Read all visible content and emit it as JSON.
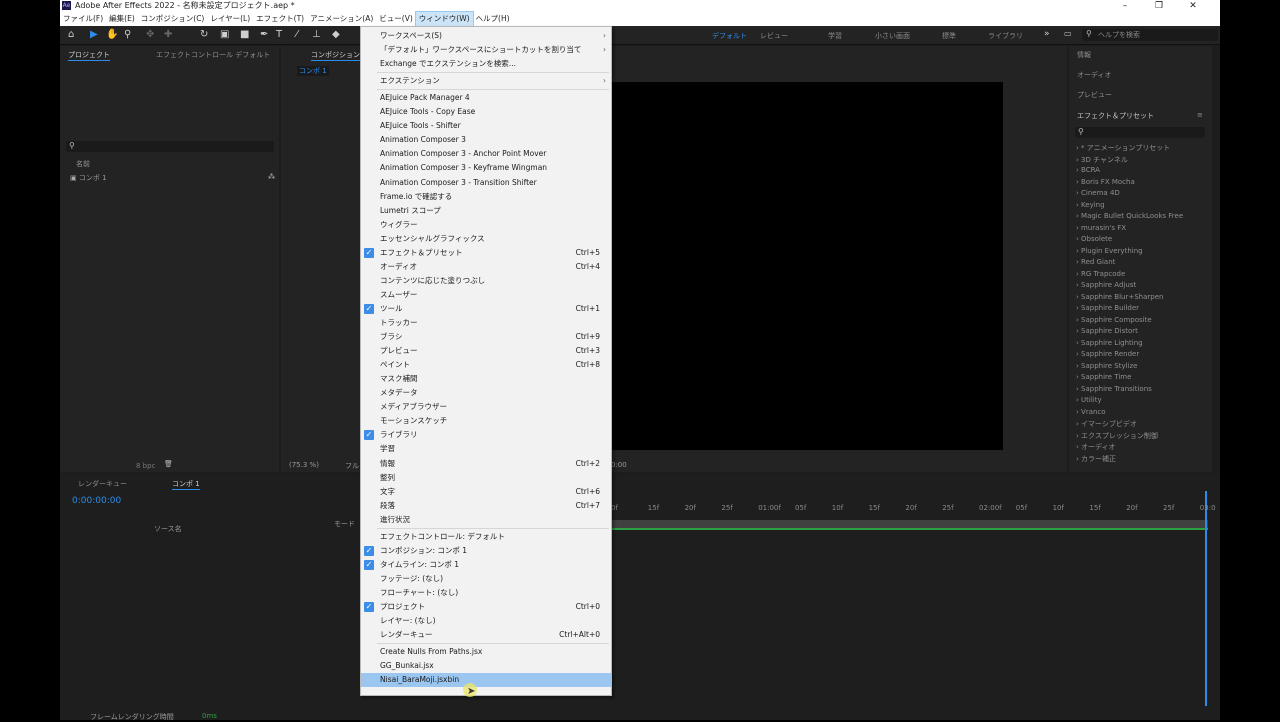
{
  "app": {
    "title": "Adobe After Effects 2022 - 名称未設定プロジェクト.aep *",
    "logo": "Ae",
    "minimize": "–",
    "maximize": "❐",
    "close": "✕"
  },
  "menubar": [
    "ファイル(F)",
    "編集(E)",
    "コンポジション(C)",
    "レイヤー(L)",
    "エフェクト(T)",
    "アニメーション(A)",
    "ビュー(V)",
    "ウィンドウ(W)",
    "ヘルプ(H)"
  ],
  "menubar_active": "ウィンドウ(W)",
  "toolbar": {
    "workspaces": [
      "デフォルト",
      "レビュー",
      "学習",
      "小さい画面",
      "標準",
      "ライブラリ"
    ],
    "current_workspace": "デフォルト",
    "overflow": "»",
    "help_search_placeholder": "ヘルプを検索"
  },
  "project_panel": {
    "tab_project": "プロジェクト",
    "tab_effect_controls": "エフェクトコントロール デフォルト",
    "column_name": "名前",
    "items": [
      "コンポ 1"
    ],
    "bpc": "8 bpc"
  },
  "comp_panel": {
    "tab": "コンポジション",
    "sub_tab": "コンポ 1",
    "zoom": "(75.3 %)",
    "res": "フル",
    "timecode": "0:00"
  },
  "right_panel": {
    "info": "情報",
    "audio": "オーディオ",
    "preview": "プレビュー",
    "effects_presets": "エフェクト＆プリセット",
    "effects": [
      "* アニメーションプリセット",
      "3D チャンネル",
      "BCRA",
      "Boris FX Mocha",
      "Cinema 4D",
      "Keying",
      "Magic Bullet QuickLooks Free",
      "murasin's FX",
      "Obsolete",
      "Plugin Everything",
      "Red Giant",
      "RG Trapcode",
      "Sapphire Adjust",
      "Sapphire Blur+Sharpen",
      "Sapphire Builder",
      "Sapphire Composite",
      "Sapphire Distort",
      "Sapphire Lighting",
      "Sapphire Render",
      "Sapphire Stylize",
      "Sapphire Time",
      "Sapphire Transitions",
      "Utility",
      "Vranco",
      "イマーシブビデオ",
      "エクスプレッション制御",
      "オーディオ",
      "カラー補正"
    ]
  },
  "timeline": {
    "tab_render_queue": "レンダーキュー",
    "tab_comp": "コンポ 1",
    "timecode": "0:00:00:00",
    "col_source": "ソース名",
    "col_mode": "モード",
    "ruler": [
      "0f",
      "15f",
      "20f",
      "25f",
      "01:00f",
      "05f",
      "10f",
      "15f",
      "20f",
      "25f",
      "02:00f",
      "05f",
      "10f",
      "15f",
      "20f",
      "25f",
      "03:0"
    ],
    "status": "フレームレンダリング時間",
    "status_value": "0ms"
  },
  "window_menu": {
    "items": [
      {
        "label": "ワークスペース(S)",
        "submenu": true
      },
      {
        "label": "「デフォルト」ワークスペースにショートカットを割り当て",
        "submenu": true
      },
      {
        "label": "Exchange でエクステンションを検索..."
      },
      {
        "sep": true
      },
      {
        "label": "エクステンション",
        "submenu": true
      },
      {
        "sep": true
      },
      {
        "label": "AEJuice Pack Manager 4"
      },
      {
        "label": "AEJuice Tools - Copy Ease"
      },
      {
        "label": "AEJuice Tools - Shifter"
      },
      {
        "label": "Animation Composer 3"
      },
      {
        "label": "Animation Composer 3 - Anchor Point Mover"
      },
      {
        "label": "Animation Composer 3 - Keyframe Wingman"
      },
      {
        "label": "Animation Composer 3 - Transition Shifter"
      },
      {
        "label": "Frame.io で確認する"
      },
      {
        "label": "Lumetri スコープ"
      },
      {
        "label": "ウィグラー"
      },
      {
        "label": "エッセンシャルグラフィックス"
      },
      {
        "label": "エフェクト＆プリセット",
        "checked": true,
        "shortcut": "Ctrl+5"
      },
      {
        "label": "オーディオ",
        "shortcut": "Ctrl+4"
      },
      {
        "label": "コンテンツに応じた塗りつぶし"
      },
      {
        "label": "スムーザー"
      },
      {
        "label": "ツール",
        "checked": true,
        "shortcut": "Ctrl+1"
      },
      {
        "label": "トラッカー"
      },
      {
        "label": "ブラシ",
        "shortcut": "Ctrl+9"
      },
      {
        "label": "プレビュー",
        "shortcut": "Ctrl+3"
      },
      {
        "label": "ペイント",
        "shortcut": "Ctrl+8"
      },
      {
        "label": "マスク補間"
      },
      {
        "label": "メタデータ"
      },
      {
        "label": "メディアブラウザー"
      },
      {
        "label": "モーションスケッチ"
      },
      {
        "label": "ライブラリ",
        "checked": true
      },
      {
        "label": "学習"
      },
      {
        "label": "情報",
        "shortcut": "Ctrl+2"
      },
      {
        "label": "整列"
      },
      {
        "label": "文字",
        "shortcut": "Ctrl+6"
      },
      {
        "label": "段落",
        "shortcut": "Ctrl+7"
      },
      {
        "label": "進行状況"
      },
      {
        "sep": true
      },
      {
        "label": "エフェクトコントロール: デフォルト"
      },
      {
        "label": "コンポジション: コンポ 1",
        "checked": true
      },
      {
        "label": "タイムライン: コンポ 1",
        "checked": true
      },
      {
        "label": "フッテージ: (なし)"
      },
      {
        "label": "フローチャート: (なし)"
      },
      {
        "label": "プロジェクト",
        "checked": true,
        "shortcut": "Ctrl+0"
      },
      {
        "label": "レイヤー: (なし)"
      },
      {
        "label": "レンダーキュー",
        "shortcut": "Ctrl+Alt+0"
      },
      {
        "sep": true
      },
      {
        "label": "Create Nulls From Paths.jsx"
      },
      {
        "label": "GG_Bunkai.jsx"
      },
      {
        "label": "Nisai_BaraMoji.jsxbin",
        "highlighted": true
      }
    ]
  },
  "colors": {
    "accent": "#2d8ceb",
    "menu_bg": "#f2f2f2",
    "menu_highlight": "#9ac6ef",
    "panel_bg": "#232323"
  }
}
